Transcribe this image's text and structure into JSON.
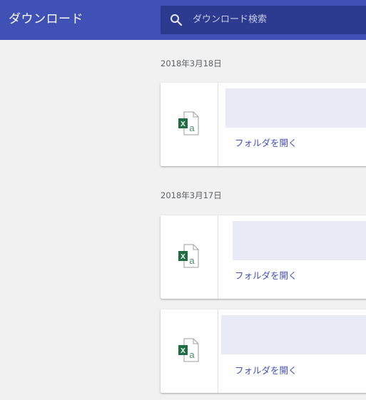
{
  "header": {
    "title": "ダウンロード",
    "search_placeholder": "ダウンロード検索"
  },
  "groups": [
    {
      "date": "2018年3月18日",
      "items": [
        {
          "icon": "excel-file-icon",
          "open_folder_label": "フォルダを開く"
        }
      ]
    },
    {
      "date": "2018年3月17日",
      "items": [
        {
          "icon": "excel-file-icon",
          "open_folder_label": "フォルダを開く"
        },
        {
          "icon": "excel-file-icon",
          "open_folder_label": "フォルダを開く"
        }
      ]
    }
  ],
  "colors": {
    "header_bg": "#3f51b5",
    "search_bg": "#2c3b8f",
    "page_bg": "#f1f1f1",
    "link": "#3f51b5",
    "name_placeholder": "#e8eaf6",
    "excel_green": "#1e6e42"
  }
}
